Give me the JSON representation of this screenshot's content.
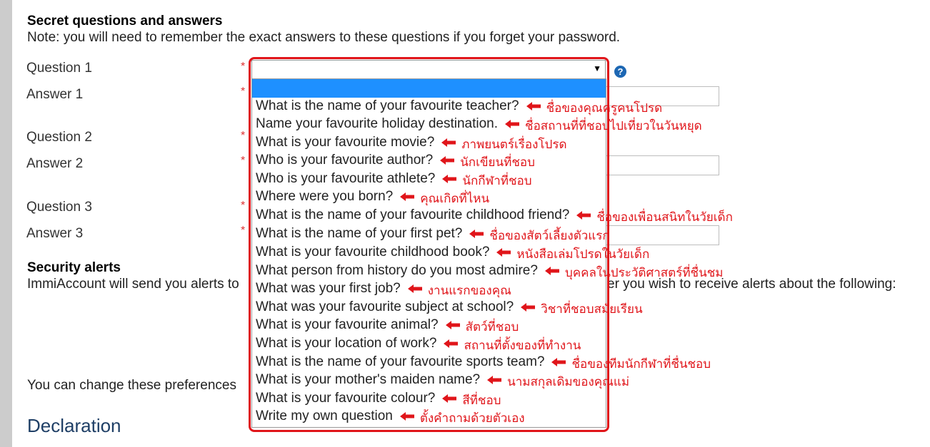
{
  "section": {
    "title": "Secret questions and answers",
    "note": "Note: you will need to remember the exact answers to these questions if you forget your password."
  },
  "form": {
    "q1": "Question 1",
    "a1": "Answer 1",
    "q2": "Question 2",
    "a2": "Answer 2",
    "q3": "Question 3",
    "a3": "Answer 3",
    "required_mark": "*",
    "help_icon": "?",
    "select_caret": "▼"
  },
  "security": {
    "title": "Security alerts",
    "text_left": "ImmiAccount will send you alerts to",
    "text_right": "er you wish to receive alerts about the following:",
    "change_text": "You can change these preferences"
  },
  "declaration": "Declaration",
  "dropdown": {
    "options": [
      "What is the name of your favourite teacher?",
      "Name your favourite holiday destination.",
      "What is your favourite movie?",
      "Who is your favourite author?",
      "Who is your favourite athlete?",
      "Where were you born?",
      "What is the name of your favourite childhood friend?",
      "What is the name of your first pet?",
      "What is your favourite childhood book?",
      "What person from history do you most admire?",
      "What was your first job?",
      "What was your favourite subject at school?",
      "What is your favourite animal?",
      "What is your location of work?",
      "What is the name of your favourite sports team?",
      "What is your mother's maiden name?",
      "What is your favourite colour?",
      "Write my own question"
    ]
  },
  "annotations": {
    "thai": [
      "ชื่อของคุณครูคนโปรด",
      "ชื่อสถานที่ที่ชอบไปเที่ยวในวันหยุด",
      "ภาพยนตร์เรื่องโปรด",
      "นักเขียนที่ชอบ",
      "นักกีฬาที่ชอบ",
      "คุณเกิดที่ไหน",
      "ชื่อของเพื่อนสนิทในวัยเด็ก",
      "ชื่อของสัตว์เลี้ยงตัวแรก",
      "หนังสือเล่มโปรดในวัยเด็ก",
      "บุคคลในประวัติศาสตร์ที่ชื่นชม",
      "งานแรกของคุณ",
      "วิชาที่ชอบสมัยเรียน",
      "สัตว์ที่ชอบ",
      "สถานที่ตั้งของที่ทำงาน",
      "ชื่อของทีมนักกีฬาที่ชื่นชอบ",
      "นามสกุลเดิมของคุณแม่",
      "สีที่ชอบ",
      "ตั้งคำถามด้วยตัวเอง"
    ],
    "arrow_color": "#e0151a"
  }
}
